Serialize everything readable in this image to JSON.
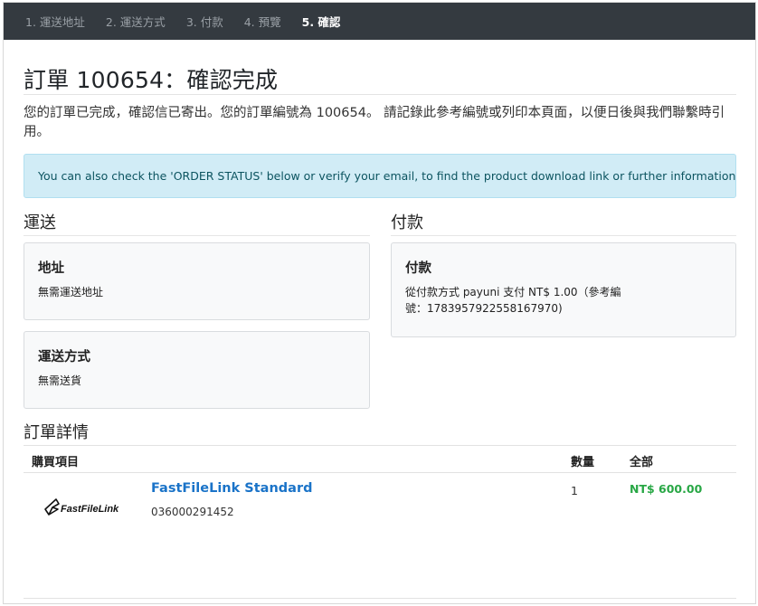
{
  "steps": [
    {
      "label": "1. 運送地址",
      "active": false
    },
    {
      "label": "2. 運送方式",
      "active": false
    },
    {
      "label": "3. 付款",
      "active": false
    },
    {
      "label": "4. 預覽",
      "active": false
    },
    {
      "label": "5. 確認",
      "active": true
    }
  ],
  "page_title": "訂單 100654：確認完成",
  "lead": "您的訂單已完成，確認信已寄出。您的訂單編號為 100654。 請記錄此參考編號或列印本頁面，以便日後與我們聯繫時引用。",
  "alert": "You can also check the 'ORDER STATUS' below or verify your email, to find the product download link or further information.",
  "shipping": {
    "heading": "運送",
    "address": {
      "title": "地址",
      "text": "無需運送地址"
    },
    "method": {
      "title": "運送方式",
      "text": "無需送貨"
    }
  },
  "payment": {
    "heading": "付款",
    "card": {
      "title": "付款",
      "text": "從付款方式 payuni 支付 NT$ 1.00（參考編號：1783957922558167970)"
    }
  },
  "order_details": {
    "heading": "訂單詳情",
    "columns": {
      "item": "購買項目",
      "qty": "數量",
      "total": "全部"
    },
    "items": [
      {
        "name": "FastFileLink Standard",
        "sku": "036000291452",
        "qty": "1",
        "total": "NT$ 600.00",
        "logo_text": "FastFileLink",
        "logo_icon": "paper-plane-logo"
      }
    ]
  },
  "colors": {
    "nav_bg": "#343a40",
    "link": "#1a73c8",
    "price": "#28a745",
    "alert_bg": "#d1ecf6"
  }
}
